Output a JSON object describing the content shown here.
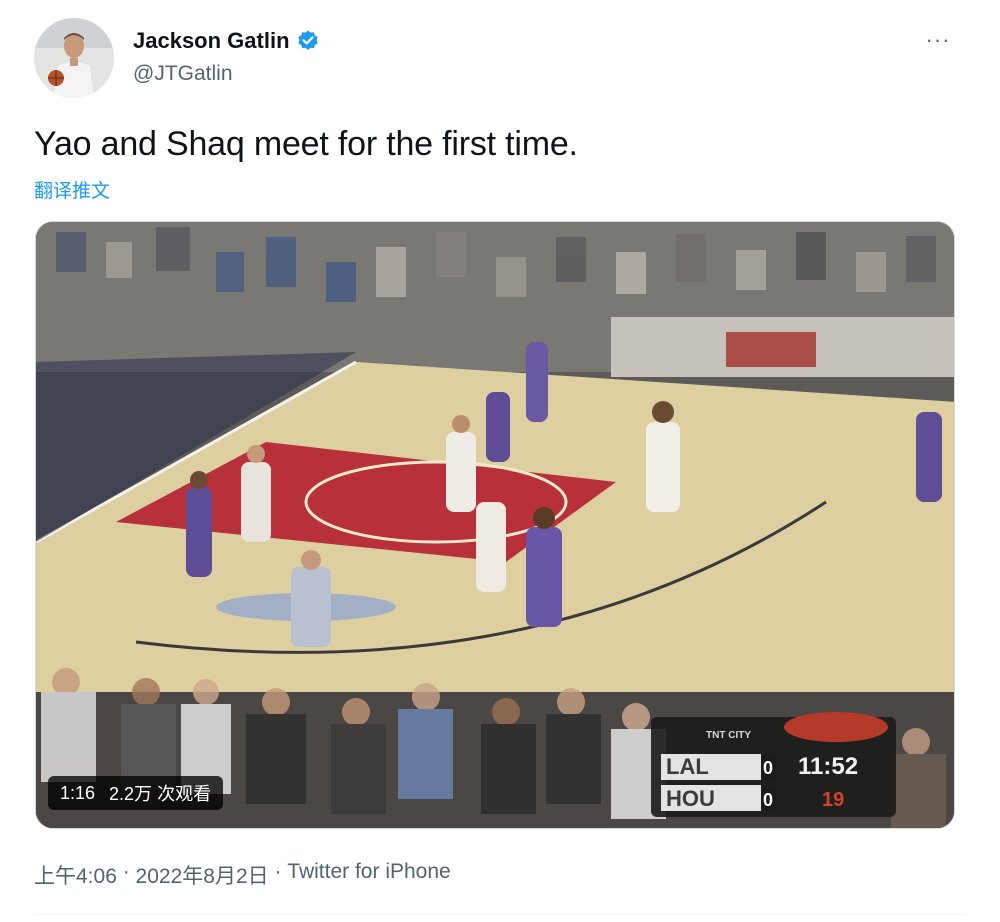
{
  "author": {
    "name": "Jackson Gatlin",
    "handle": "@JTGatlin",
    "verified_icon": "verified-badge-icon",
    "verified_color": "#1d9bf0"
  },
  "more_label": "···",
  "tweet": {
    "text": "Yao and Shaq meet for the first time.",
    "translate_label": "翻译推文"
  },
  "video": {
    "duration": "1:16",
    "views": "2.2万 次观看",
    "scoreboard": {
      "network": "TNT CITY",
      "team1": "LAL",
      "score1": "0",
      "team2": "HOU",
      "score2": "0",
      "clock": "11:52",
      "shot_clock": "19"
    }
  },
  "meta": {
    "time": "上午4:06",
    "separator1": " · ",
    "date": "2022年8月2日",
    "separator2": " · ",
    "source": "Twitter for iPhone"
  },
  "colors": {
    "text_primary": "#0f1419",
    "text_secondary": "#536471",
    "link": "#1d9bf0"
  }
}
